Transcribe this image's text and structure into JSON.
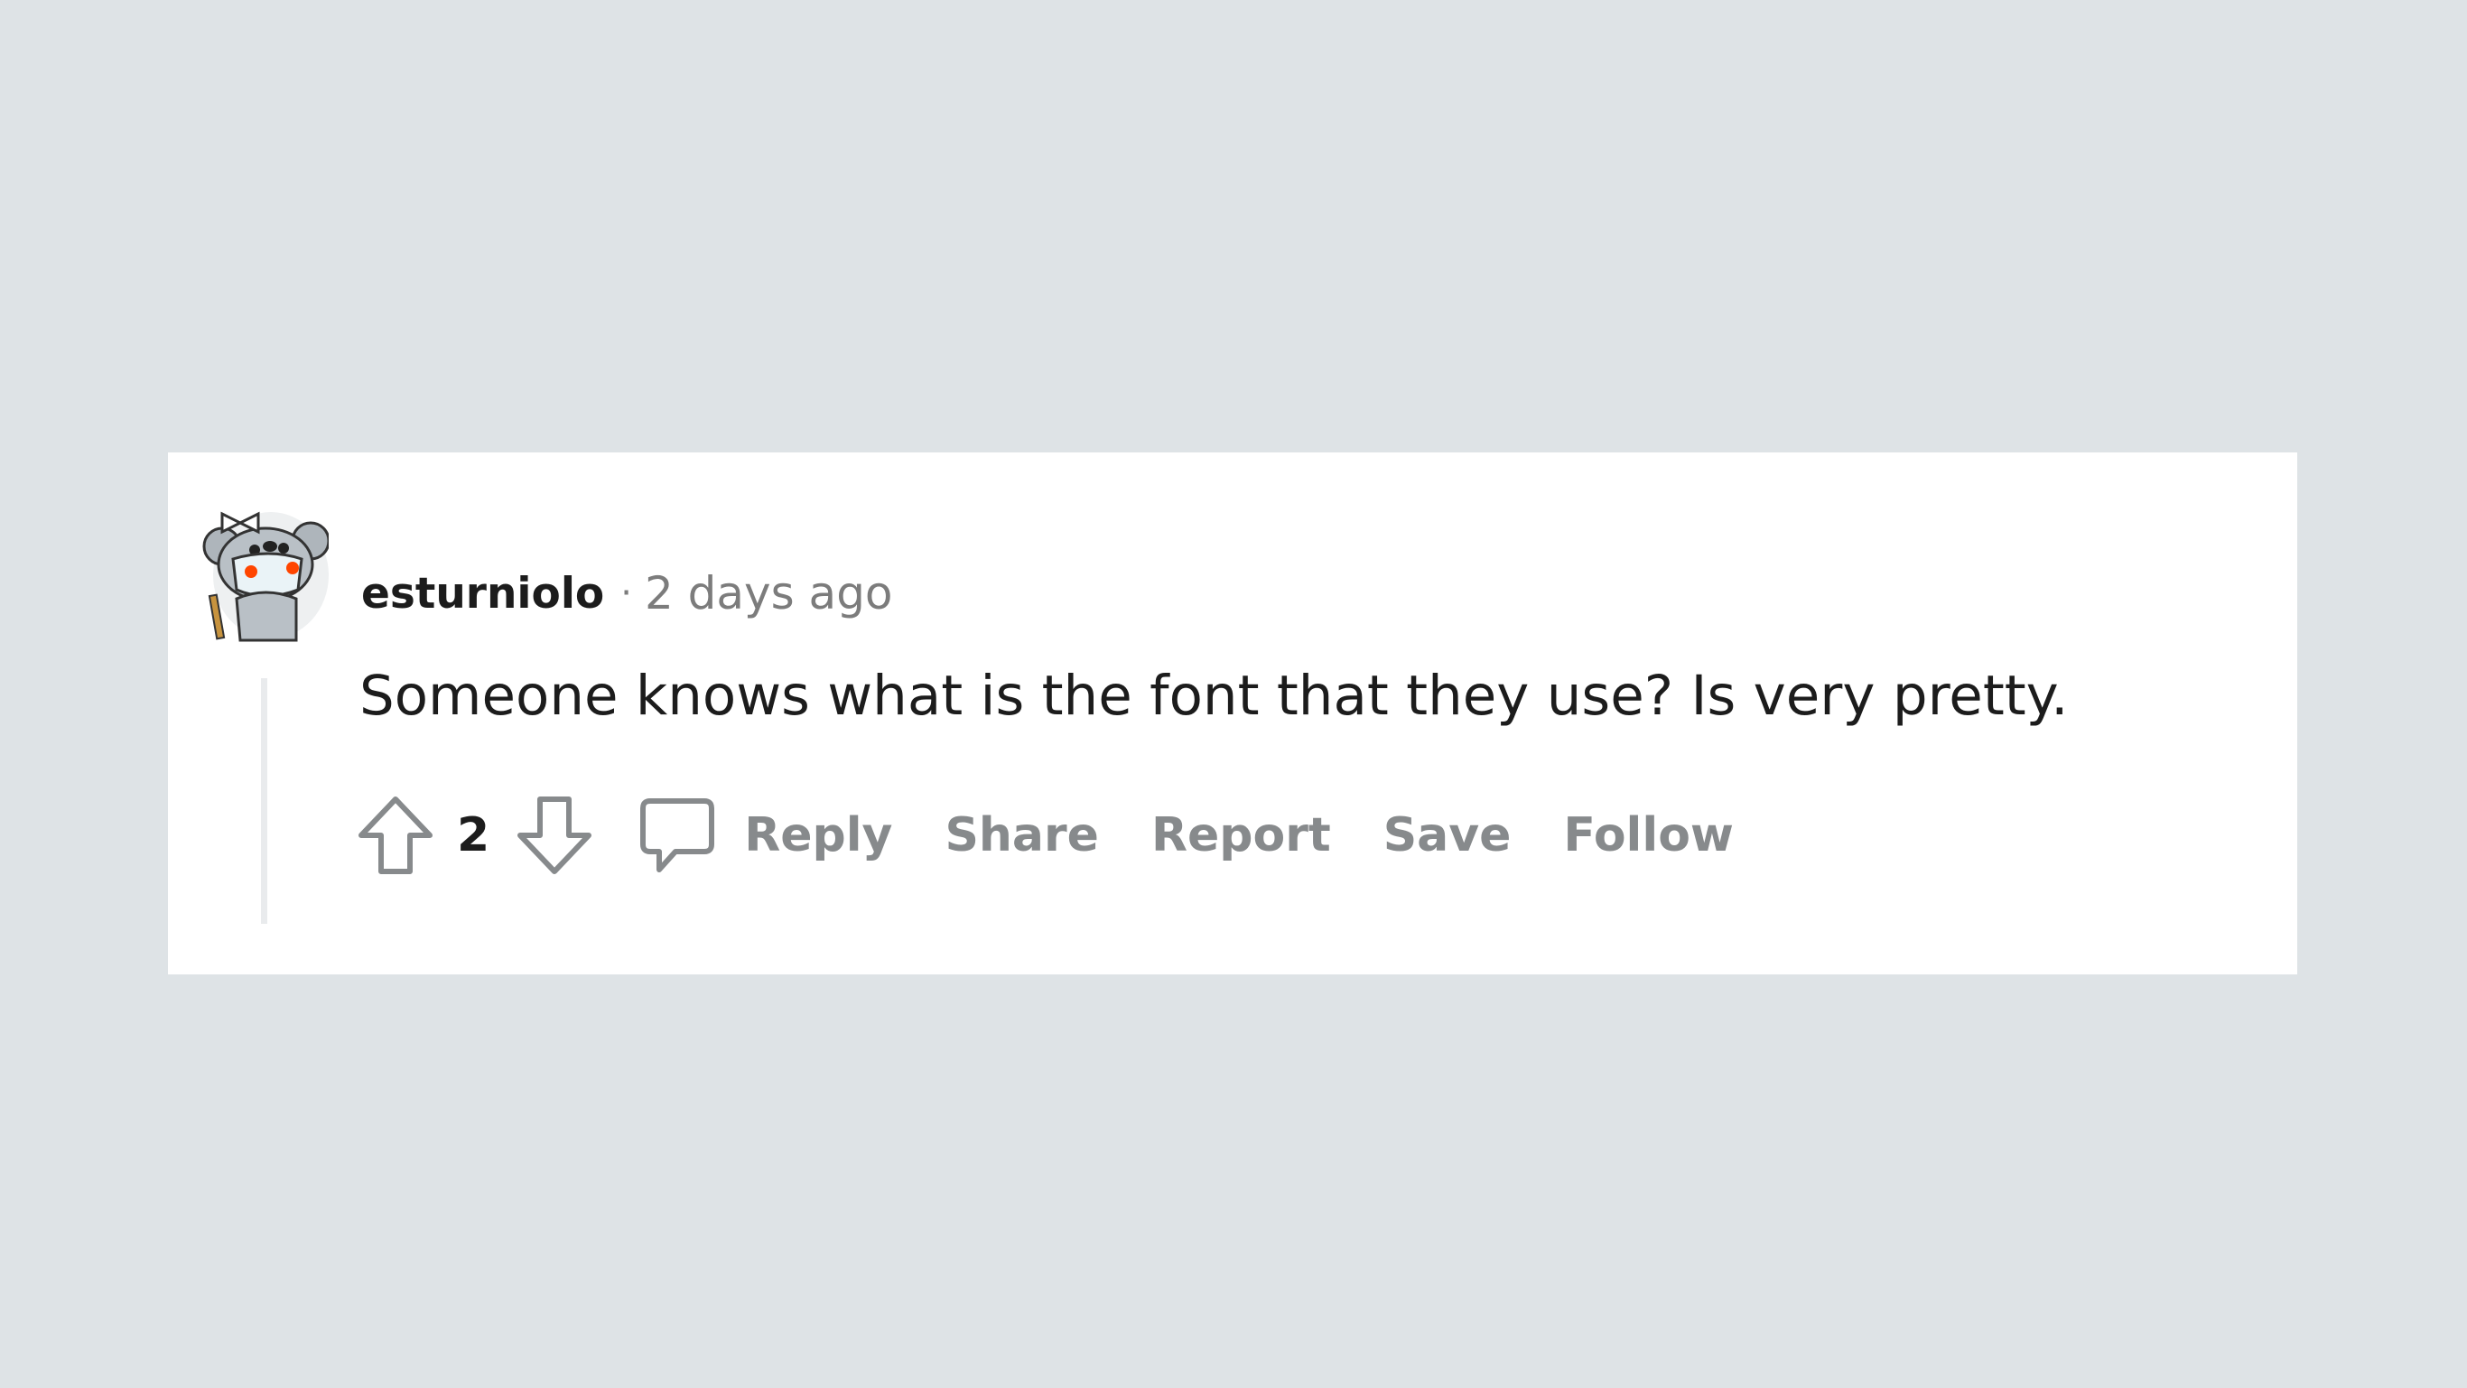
{
  "comment": {
    "author": "esturniolo",
    "separator": "·",
    "timestamp": "2 days ago",
    "text": "Someone knows what is the font that they use? Is very pretty.",
    "score": "2"
  },
  "actions": {
    "reply": "Reply",
    "share": "Share",
    "report": "Report",
    "save": "Save",
    "follow": "Follow"
  },
  "icons": {
    "upvote": "upvote-arrow-icon",
    "downvote": "downvote-arrow-icon",
    "comment": "comment-bubble-icon",
    "avatar": "snoo-koala-avatar"
  },
  "colors": {
    "page_background": "#dee3e6",
    "card_background": "#ffffff",
    "muted_text": "#878a8c",
    "primary_text": "#1c1c1c"
  }
}
